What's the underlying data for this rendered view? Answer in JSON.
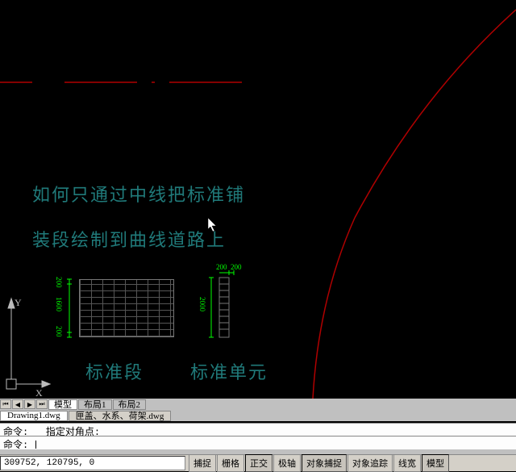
{
  "annotation": {
    "line1": "如何只通过中线把标准铺",
    "line2": "装段绘制到曲线道路上",
    "seg_label": "标准段",
    "unit_label": "标准单元"
  },
  "ucs": {
    "y": "Y",
    "x": "X"
  },
  "dims": {
    "seg_top": "200",
    "seg_mid": "1600",
    "seg_bot": "200",
    "unit_h": "2000",
    "unit_top": "200",
    "unit_right": "200"
  },
  "layout_tabs": {
    "model": "模型",
    "layout1": "布局1",
    "layout2": "布局2"
  },
  "file_tabs": {
    "active": "Drawing1.dwg",
    "inactive": "匣盖、水系、荷架.dwg"
  },
  "command": {
    "line1_prefix": "命令:",
    "line1_text": "指定对角点:",
    "line2_prefix": "命令:"
  },
  "status": {
    "coords": "309752, 120795, 0",
    "buttons": {
      "snap": "捕捉",
      "grid": "栅格",
      "ortho": "正交",
      "polar": "极轴",
      "osnap": "对象捕捉",
      "otrack": "对象追踪",
      "lwt": "线宽",
      "model": "模型"
    }
  }
}
